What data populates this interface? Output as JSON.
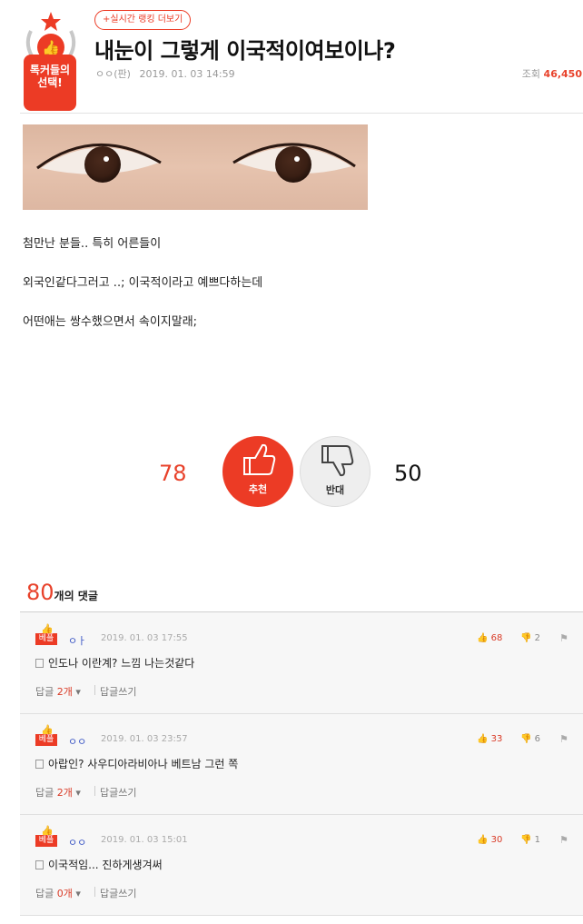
{
  "header": {
    "badge_line1": "톡커들의",
    "badge_line2": "선택!",
    "ranking_link": "+실시간 랭킹 더보기",
    "title": "내눈이 그렇게 이국적이여보이나?",
    "author": "ㅇㅇ(판)",
    "date": "2019. 01. 03 14:59",
    "views_label": "조회",
    "views_value": "46,450"
  },
  "post": {
    "lines": [
      "첨만난 분들.. 특히 어른들이",
      "외국인같다그러고 ..; 이국적이라고 예쁘다하는데",
      "어떤애는 쌍수했으면서 속이지말래;"
    ]
  },
  "votes": {
    "up_count": "78",
    "up_label": "추천",
    "down_count": "50",
    "down_label": "반대"
  },
  "comments_header": {
    "count": "80",
    "suffix": "개의 댓글"
  },
  "comments": [
    {
      "tag": "베플",
      "author": "ㅇㅏ",
      "date": "2019. 01. 03 17:55",
      "likes": "68",
      "dislikes": "2",
      "text": "인도나 이란계? 느낌 나는것같다",
      "reply_label": "답글",
      "reply_count": "2개",
      "write_label": "답글쓰기"
    },
    {
      "tag": "베플",
      "author": "ㅇㅇ",
      "date": "2019. 01. 03 23:57",
      "likes": "33",
      "dislikes": "6",
      "text": "아랍인? 사우디아라비아나 베트남 그런 쪽",
      "reply_label": "답글",
      "reply_count": "2개",
      "write_label": "답글쓰기"
    },
    {
      "tag": "베플",
      "author": "ㅇㅇ",
      "date": "2019. 01. 03 15:01",
      "likes": "30",
      "dislikes": "1",
      "text": "이국적임... 진하게생겨써",
      "reply_label": "답글",
      "reply_count": "0개",
      "write_label": "답글쓰기"
    }
  ],
  "colors": {
    "accent": "#ec3b25",
    "author_blue": "#3a55c4"
  }
}
